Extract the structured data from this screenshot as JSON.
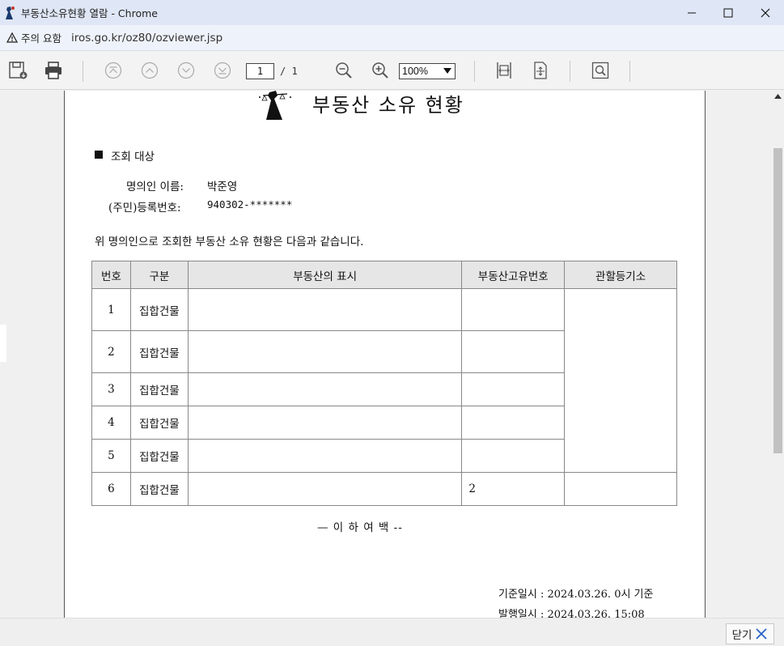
{
  "window": {
    "title": "부동산소유현황 열람 - Chrome",
    "minimize": "—",
    "maximize": "☐",
    "close": "✕"
  },
  "address": {
    "warning_label": "주의 요함",
    "url": "iros.go.kr/oz80/ozviewer.jsp"
  },
  "toolbar": {
    "icons": [
      "save-icon",
      "print-icon",
      "first-page-icon",
      "prev-page-icon",
      "next-page-icon",
      "last-page-icon",
      "zoom-out-icon",
      "zoom-in-icon",
      "fit-width-icon",
      "fit-page-icon",
      "find-icon"
    ],
    "current_page": "1",
    "total_pages": "/ 1",
    "zoom": "100%"
  },
  "document": {
    "title": "부동산 소유 현황",
    "section_title": "조회 대상",
    "owner_name_label": "명의인 이름:",
    "owner_name": "박준영",
    "reg_no_label": "(주민)등록번호:",
    "reg_no": "940302-*******",
    "intro": "위 명의인으로 조회한 부동산 소유 현황은 다음과 같습니다.",
    "table": {
      "headers": [
        "번호",
        "구분",
        "부동산의 표시",
        "부동산고유번호",
        "관할등기소"
      ],
      "rows": [
        {
          "no": "1",
          "type": "집합건물"
        },
        {
          "no": "2",
          "type": "집합건물"
        },
        {
          "no": "3",
          "type": "집합건물"
        },
        {
          "no": "4",
          "type": "집합건물"
        },
        {
          "no": "5",
          "type": "집합건물"
        },
        {
          "no": "6",
          "type": "집합건물",
          "unique_no": "2"
        }
      ]
    },
    "end_mark": "— 이  하  여  백 --",
    "base_date_label": "기준일시 :",
    "base_date": "2024.03.26. 0시 기준",
    "issue_date_label": "발행일시 :",
    "issue_date": "2024.03.26. 15:08"
  },
  "footer": {
    "close_label": "닫기"
  }
}
